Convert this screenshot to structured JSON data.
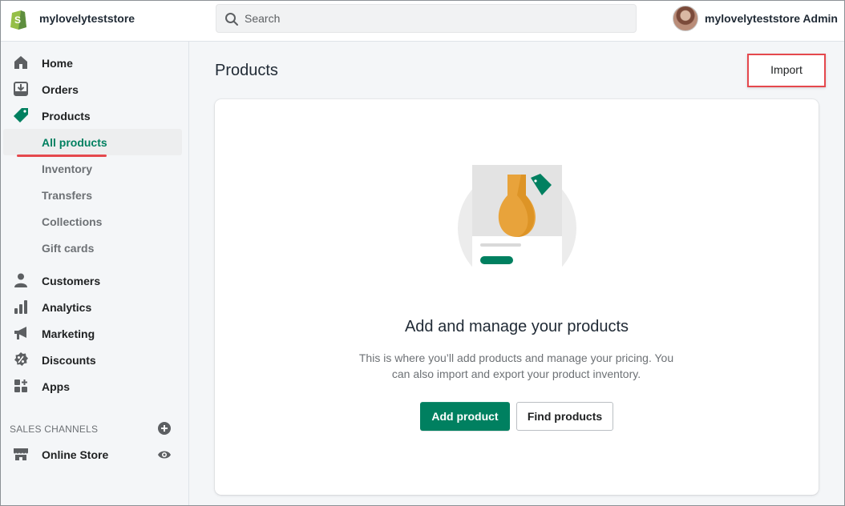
{
  "store": {
    "name": "mylovelyteststore",
    "admin_name": "mylovelyteststore Admin"
  },
  "search": {
    "placeholder": "Search"
  },
  "sidebar": {
    "items": [
      {
        "label": "Home",
        "icon": "home-icon"
      },
      {
        "label": "Orders",
        "icon": "orders-icon"
      },
      {
        "label": "Products",
        "icon": "tag-icon"
      },
      {
        "label": "Customers",
        "icon": "person-icon"
      },
      {
        "label": "Analytics",
        "icon": "bar-chart-icon"
      },
      {
        "label": "Marketing",
        "icon": "megaphone-icon"
      },
      {
        "label": "Discounts",
        "icon": "discount-icon"
      },
      {
        "label": "Apps",
        "icon": "apps-icon"
      }
    ],
    "sub_items": [
      {
        "label": "All products",
        "active": true
      },
      {
        "label": "Inventory"
      },
      {
        "label": "Transfers"
      },
      {
        "label": "Collections"
      },
      {
        "label": "Gift cards"
      }
    ],
    "sales_channels_title": "SALES CHANNELS",
    "online_store_label": "Online Store"
  },
  "main": {
    "title": "Products",
    "import_label": "Import",
    "empty_state": {
      "heading": "Add and manage your products",
      "description": "This is where you’ll add products and manage your pricing. You can also import and export your product inventory.",
      "primary_label": "Add product",
      "secondary_label": "Find products"
    }
  },
  "colors": {
    "accent": "#008060",
    "highlight": "#e5484d"
  }
}
